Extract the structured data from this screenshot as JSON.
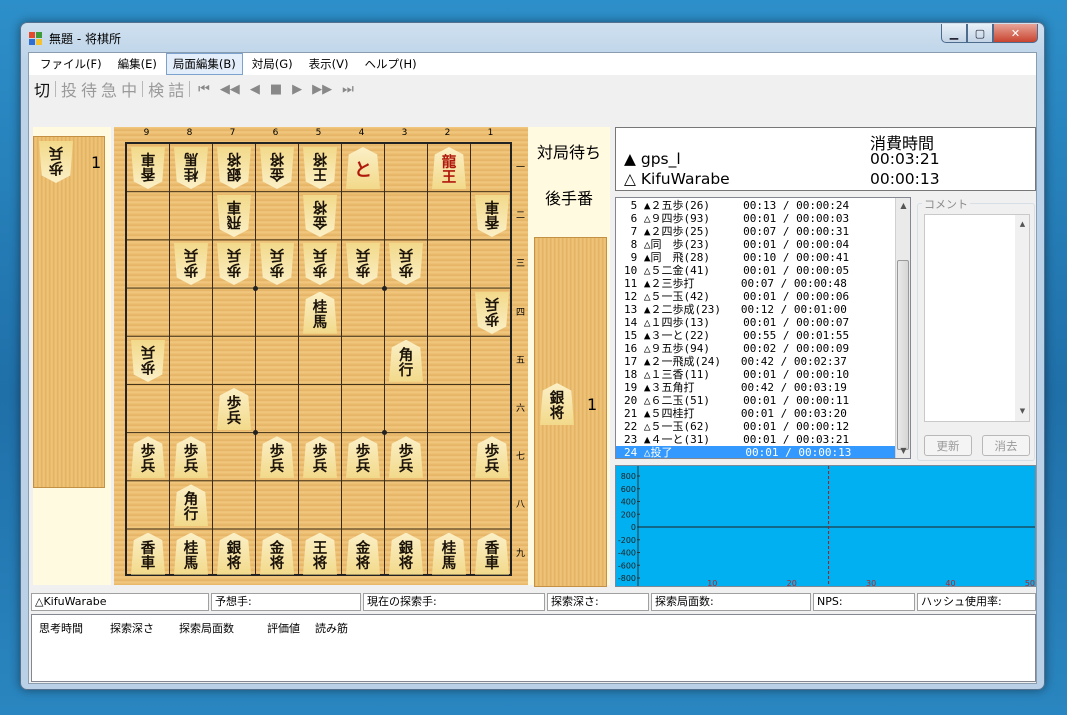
{
  "window": {
    "title": "無題 - 将棋所",
    "close_glyph": "✕",
    "max_glyph": "▢",
    "min_glyph": "▁"
  },
  "menu": [
    {
      "label": "ファイル(F)",
      "active": false
    },
    {
      "label": "編集(E)",
      "active": false
    },
    {
      "label": "局面編集(B)",
      "active": true
    },
    {
      "label": "対局(G)",
      "active": false
    },
    {
      "label": "表示(V)",
      "active": false
    },
    {
      "label": "ヘルプ(H)",
      "active": false
    }
  ],
  "toolbar": {
    "cut": "切",
    "resign": "投",
    "wait": "待",
    "hurry": "急",
    "stop": "中",
    "study": "検",
    "tsume": "詰",
    "nav_first": "⏮",
    "nav_back5": "◀◀",
    "nav_back": "◀",
    "nav_stop": "■",
    "nav_fwd": "▶",
    "nav_fwd5": "▶▶",
    "nav_last": "⏭"
  },
  "board": {
    "files": [
      "9",
      "8",
      "7",
      "6",
      "5",
      "4",
      "3",
      "2",
      "1"
    ],
    "ranks": [
      "一",
      "二",
      "三",
      "四",
      "五",
      "六",
      "七",
      "八",
      "九"
    ],
    "pieces": [
      {
        "f": 0,
        "r": 0,
        "t": [
          "香",
          "車"
        ],
        "gote": true
      },
      {
        "f": 1,
        "r": 0,
        "t": [
          "桂",
          "馬"
        ],
        "gote": true
      },
      {
        "f": 2,
        "r": 0,
        "t": [
          "銀",
          "将"
        ],
        "gote": true
      },
      {
        "f": 3,
        "r": 0,
        "t": [
          "金",
          "将"
        ],
        "gote": true
      },
      {
        "f": 4,
        "r": 0,
        "t": [
          "王",
          "将"
        ],
        "gote": true
      },
      {
        "f": 5,
        "r": 0,
        "t": [
          "と"
        ],
        "gote": false,
        "one": true,
        "red": true
      },
      {
        "f": 7,
        "r": 0,
        "t": [
          "龍",
          "王"
        ],
        "gote": false,
        "red": true
      },
      {
        "f": 2,
        "r": 1,
        "t": [
          "飛",
          "車"
        ],
        "gote": true
      },
      {
        "f": 4,
        "r": 1,
        "t": [
          "金",
          "将"
        ],
        "gote": true
      },
      {
        "f": 8,
        "r": 1,
        "t": [
          "香",
          "車"
        ],
        "gote": true
      },
      {
        "f": 1,
        "r": 2,
        "t": [
          "歩",
          "兵"
        ],
        "gote": true
      },
      {
        "f": 2,
        "r": 2,
        "t": [
          "歩",
          "兵"
        ],
        "gote": true
      },
      {
        "f": 3,
        "r": 2,
        "t": [
          "歩",
          "兵"
        ],
        "gote": true
      },
      {
        "f": 4,
        "r": 2,
        "t": [
          "歩",
          "兵"
        ],
        "gote": true
      },
      {
        "f": 5,
        "r": 2,
        "t": [
          "歩",
          "兵"
        ],
        "gote": true
      },
      {
        "f": 6,
        "r": 2,
        "t": [
          "歩",
          "兵"
        ],
        "gote": true
      },
      {
        "f": 4,
        "r": 3,
        "t": [
          "桂",
          "馬"
        ],
        "gote": false
      },
      {
        "f": 8,
        "r": 3,
        "t": [
          "歩",
          "兵"
        ],
        "gote": true
      },
      {
        "f": 0,
        "r": 4,
        "t": [
          "歩",
          "兵"
        ],
        "gote": true
      },
      {
        "f": 6,
        "r": 4,
        "t": [
          "角",
          "行"
        ],
        "gote": false
      },
      {
        "f": 2,
        "r": 5,
        "t": [
          "歩",
          "兵"
        ],
        "gote": false
      },
      {
        "f": 0,
        "r": 6,
        "t": [
          "歩",
          "兵"
        ],
        "gote": false
      },
      {
        "f": 1,
        "r": 6,
        "t": [
          "歩",
          "兵"
        ],
        "gote": false
      },
      {
        "f": 3,
        "r": 6,
        "t": [
          "歩",
          "兵"
        ],
        "gote": false
      },
      {
        "f": 4,
        "r": 6,
        "t": [
          "歩",
          "兵"
        ],
        "gote": false
      },
      {
        "f": 5,
        "r": 6,
        "t": [
          "歩",
          "兵"
        ],
        "gote": false
      },
      {
        "f": 6,
        "r": 6,
        "t": [
          "歩",
          "兵"
        ],
        "gote": false
      },
      {
        "f": 8,
        "r": 6,
        "t": [
          "歩",
          "兵"
        ],
        "gote": false
      },
      {
        "f": 1,
        "r": 7,
        "t": [
          "角",
          "行"
        ],
        "gote": false
      },
      {
        "f": 0,
        "r": 8,
        "t": [
          "香",
          "車"
        ],
        "gote": false
      },
      {
        "f": 1,
        "r": 8,
        "t": [
          "桂",
          "馬"
        ],
        "gote": false
      },
      {
        "f": 2,
        "r": 8,
        "t": [
          "銀",
          "将"
        ],
        "gote": false
      },
      {
        "f": 3,
        "r": 8,
        "t": [
          "金",
          "将"
        ],
        "gote": false
      },
      {
        "f": 4,
        "r": 8,
        "t": [
          "王",
          "将"
        ],
        "gote": false
      },
      {
        "f": 5,
        "r": 8,
        "t": [
          "金",
          "将"
        ],
        "gote": false
      },
      {
        "f": 6,
        "r": 8,
        "t": [
          "銀",
          "将"
        ],
        "gote": false
      },
      {
        "f": 7,
        "r": 8,
        "t": [
          "桂",
          "馬"
        ],
        "gote": false
      },
      {
        "f": 8,
        "r": 8,
        "t": [
          "香",
          "車"
        ],
        "gote": false
      }
    ]
  },
  "gote_hand": {
    "piece": [
      "歩",
      "兵"
    ],
    "count": "1"
  },
  "sente_hand": {
    "piece": [
      "銀",
      "将"
    ],
    "count": "1"
  },
  "status": {
    "waiting": "対局待ち",
    "turn": "後手番"
  },
  "players": {
    "time_header": "消費時間",
    "sente_mark": "▲",
    "sente_name": "gps_l",
    "sente_time": "00:03:21",
    "gote_mark": "△",
    "gote_name": "KifuWarabe",
    "gote_time": "00:00:13"
  },
  "kifu": [
    {
      "n": " 5",
      "m": "▲２五歩(26)  ",
      "t": "00:13 / 00:00:24"
    },
    {
      "n": " 6",
      "m": "△９四歩(93)  ",
      "t": "00:01 / 00:00:03"
    },
    {
      "n": " 7",
      "m": "▲２四歩(25)  ",
      "t": "00:07 / 00:00:31"
    },
    {
      "n": " 8",
      "m": "△同　歩(23)  ",
      "t": "00:01 / 00:00:04"
    },
    {
      "n": " 9",
      "m": "▲同　飛(28)  ",
      "t": "00:10 / 00:00:41"
    },
    {
      "n": "10",
      "m": "△５二金(41)  ",
      "t": "00:01 / 00:00:05"
    },
    {
      "n": "11",
      "m": "▲２三歩打    ",
      "t": "00:07 / 00:00:48"
    },
    {
      "n": "12",
      "m": "△５一玉(42)  ",
      "t": "00:01 / 00:00:06"
    },
    {
      "n": "13",
      "m": "▲２二歩成(23)",
      "t": "00:12 / 00:01:00"
    },
    {
      "n": "14",
      "m": "△１四歩(13)  ",
      "t": "00:01 / 00:00:07"
    },
    {
      "n": "15",
      "m": "▲３一と(22)  ",
      "t": "00:55 / 00:01:55"
    },
    {
      "n": "16",
      "m": "△９五歩(94)  ",
      "t": "00:02 / 00:00:09"
    },
    {
      "n": "17",
      "m": "▲２一飛成(24)",
      "t": "00:42 / 00:02:37"
    },
    {
      "n": "18",
      "m": "△１三香(11)  ",
      "t": "00:01 / 00:00:10"
    },
    {
      "n": "19",
      "m": "▲３五角打    ",
      "t": "00:42 / 00:03:19"
    },
    {
      "n": "20",
      "m": "△６二玉(51)  ",
      "t": "00:01 / 00:00:11"
    },
    {
      "n": "21",
      "m": "▲５四桂打    ",
      "t": "00:01 / 00:03:20"
    },
    {
      "n": "22",
      "m": "△５一玉(62)  ",
      "t": "00:01 / 00:00:12"
    },
    {
      "n": "23",
      "m": "▲４一と(31)  ",
      "t": "00:01 / 00:03:21"
    },
    {
      "n": "24",
      "m": "△投了        ",
      "t": "00:01 / 00:00:13",
      "sel": true
    }
  ],
  "comment": {
    "label": "コメント",
    "update": "更新",
    "delete": "消去"
  },
  "graph": {
    "y_ticks": [
      "800",
      "600",
      "400",
      "200",
      "0",
      "-200",
      "-400",
      "-600",
      "-800"
    ],
    "x_ticks": [
      "10",
      "20",
      "30",
      "40",
      "50"
    ],
    "bg": "#00b0f0"
  },
  "statusbar": {
    "engine": "△KifuWarabe",
    "expected": "予想手:",
    "current": "現在の探索手:",
    "depth": "探索深さ:",
    "nodes": "探索局面数:",
    "nps": "NPS:",
    "hash": "ハッシュ使用率:"
  },
  "think_headers": [
    "思考時間",
    "探索深さ",
    "探索局面数",
    "評価値",
    "読み筋"
  ]
}
